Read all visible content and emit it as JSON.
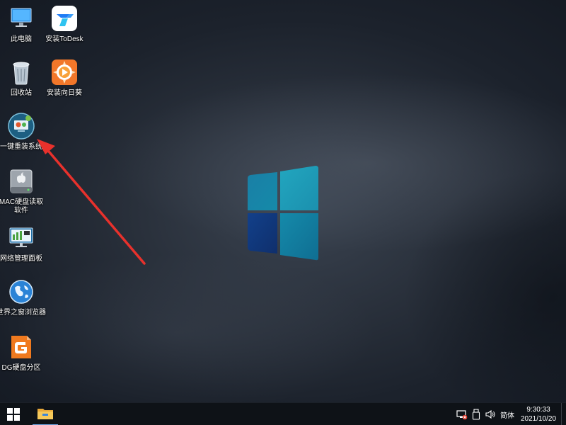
{
  "desktop": {
    "icons": [
      {
        "label": "此电脑",
        "icon": "this-pc-icon"
      },
      {
        "label": "安装ToDesk",
        "icon": "todesk-icon"
      },
      {
        "label": "回收站",
        "icon": "recycle-bin-icon"
      },
      {
        "label": "安装向日葵",
        "icon": "sunflower-icon"
      },
      {
        "label": "一键重装系统",
        "icon": "one-click-reinstall-icon"
      },
      {
        "label": "MAC硬盘读取软件",
        "icon": "mac-disk-reader-icon"
      },
      {
        "label": "网络管理面板",
        "icon": "network-panel-icon"
      },
      {
        "label": "世界之窗浏览器",
        "icon": "theworld-browser-icon"
      },
      {
        "label": "DG硬盘分区",
        "icon": "diskgenius-icon"
      }
    ]
  },
  "annotation": {
    "arrow_color": "#e8312c"
  },
  "taskbar": {
    "start_icon": "windows-start-icon",
    "pinned": [
      {
        "icon": "file-explorer-icon"
      }
    ],
    "tray": {
      "ime_label": "简体",
      "time": "9:30:33",
      "date": "2021/10/20"
    }
  },
  "colors": {
    "logo_light": "#1f9bb8",
    "logo_dark": "#12387a",
    "taskbar": "#0e1217"
  }
}
